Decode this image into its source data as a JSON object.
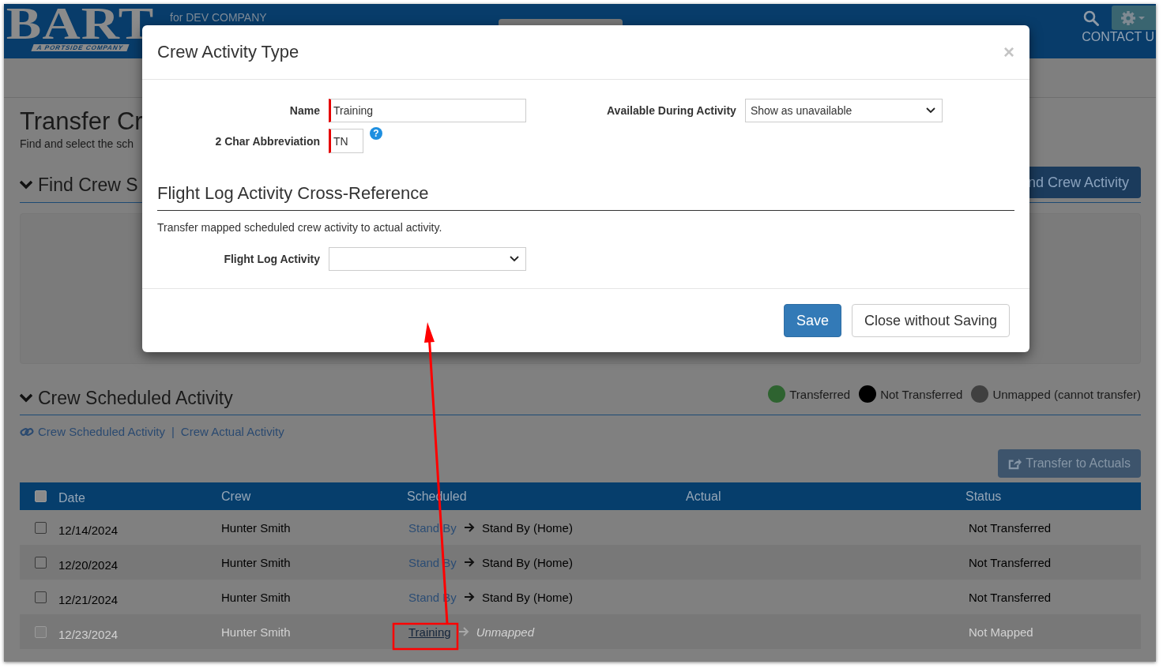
{
  "header": {
    "logo": "BART",
    "tagline": "A PORTSIDE COMPANY",
    "company": "for DEV COMPANY",
    "contact": "CONTACT U"
  },
  "page": {
    "title": "Transfer Cr",
    "subtitle": "Find and select the sch"
  },
  "find_section": {
    "title": "Find Crew S",
    "expanded": true,
    "button": "nd Crew Activity"
  },
  "scheduled_section": {
    "title": "Crew Scheduled Activity",
    "expanded": true,
    "legend": [
      {
        "label": "Transferred",
        "color": "#2e6330"
      },
      {
        "label": "Not Transferred",
        "color": "#000000"
      },
      {
        "label": "Unmapped (cannot transfer)",
        "color": "#404040"
      }
    ],
    "links": [
      "Crew Scheduled Activity",
      "Crew Actual Activity"
    ],
    "separator": "|",
    "transfer_button": {
      "label": "Transfer to Actuals",
      "disabled": true
    }
  },
  "table": {
    "select_all_checked": false,
    "columns": [
      "Date",
      "Crew",
      "Scheduled",
      "Actual",
      "Status"
    ],
    "rows": [
      {
        "checked": false,
        "disabled": false,
        "link_hovered": false,
        "date": "12/14/2024",
        "crew": "Hunter Smith",
        "scheduled": "Stand By",
        "mapped_to": "Stand By (Home)",
        "status": "Not Transferred"
      },
      {
        "checked": false,
        "disabled": false,
        "link_hovered": false,
        "date": "12/20/2024",
        "crew": "Hunter Smith",
        "scheduled": "Stand By",
        "mapped_to": "Stand By (Home)",
        "status": "Not Transferred"
      },
      {
        "checked": false,
        "disabled": false,
        "link_hovered": false,
        "date": "12/21/2024",
        "crew": "Hunter Smith",
        "scheduled": "Stand By",
        "mapped_to": "Stand By (Home)",
        "status": "Not Transferred"
      },
      {
        "checked": false,
        "disabled": true,
        "link_hovered": true,
        "date": "12/23/2024",
        "crew": "Hunter Smith",
        "scheduled": "Training",
        "mapped_to": "Unmapped",
        "status": "Not Mapped"
      }
    ]
  },
  "modal": {
    "title": "Crew Activity Type",
    "close": "×",
    "name_field": {
      "label": "Name",
      "value": "Training",
      "required": true
    },
    "abbreviation_field": {
      "label": "2 Char Abbreviation",
      "value": "TN",
      "required": true,
      "help": "?"
    },
    "availability_field": {
      "label": "Available During Activity",
      "value": "Show as unavailable"
    },
    "cross_reference": {
      "title": "Flight Log Activity Cross-Reference",
      "description": "Transfer mapped scheduled crew activity to actual activity.",
      "flight_log_field": {
        "label": "Flight Log Activity"
      }
    },
    "buttons": [
      {
        "label": "Save",
        "kind": "primary"
      },
      {
        "label": "Close without Saving",
        "kind": "default"
      }
    ]
  }
}
